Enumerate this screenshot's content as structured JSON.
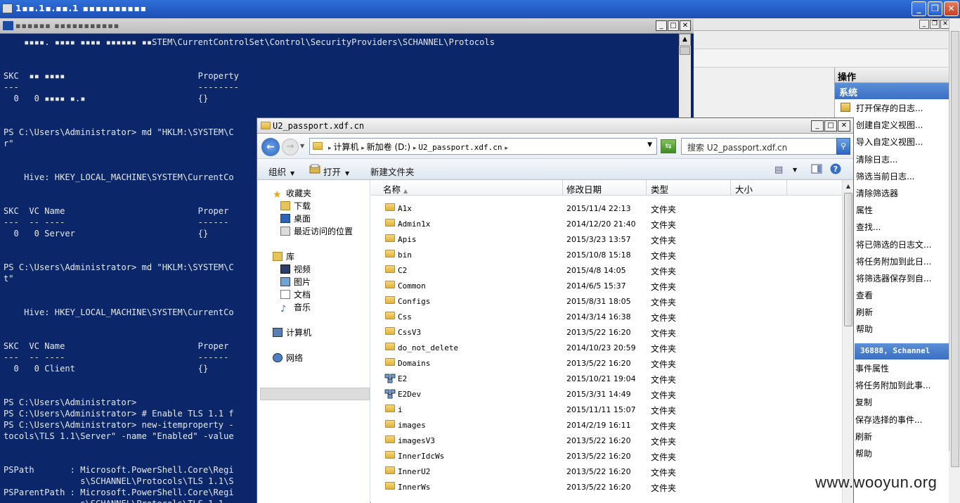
{
  "rdp": {
    "title": "1▪▪.1▪.▪▪.1  ▪▪▪▪▪▪▪▪▪▪"
  },
  "powershell": {
    "title": "▪▪▪▪▪▪  ▪▪▪▪▪▪▪▪▪▪▪",
    "lines": [
      "    ▪▪▪▪. ▪▪▪▪ ▪▪▪▪ ▪▪▪▪▪▪ ▪▪STEM\\CurrentControlSet\\Control\\SecurityProviders\\SCHANNEL\\Protocols",
      "",
      "",
      "SKC  ▪▪ ▪▪▪▪                          Property",
      "---                                   --------",
      "  0   0 ▪▪▪▪ ▪.▪                      {}",
      "",
      "",
      "PS C:\\Users\\Administrator> md \"HKLM:\\SYSTEM\\C",
      "r\"",
      "",
      "",
      "    Hive: HKEY_LOCAL_MACHINE\\SYSTEM\\CurrentCo",
      "",
      "",
      "SKC  VC Name                          Proper",
      "---  -- ----                          ------",
      "  0   0 Server                        {}",
      "",
      "",
      "PS C:\\Users\\Administrator> md \"HKLM:\\SYSTEM\\C",
      "t\"",
      "",
      "",
      "    Hive: HKEY_LOCAL_MACHINE\\SYSTEM\\CurrentCo",
      "",
      "",
      "SKC  VC Name                          Proper",
      "---  -- ----                          ------",
      "  0   0 Client                        {}",
      "",
      "",
      "PS C:\\Users\\Administrator>",
      "PS C:\\Users\\Administrator> # Enable TLS 1.1 f",
      "PS C:\\Users\\Administrator> new-itemproperty -",
      "tocols\\TLS 1.1\\Server\" -name \"Enabled\" -value",
      "",
      "",
      "PSPath       : Microsoft.PowerShell.Core\\Regi",
      "               s\\SCHANNEL\\Protocols\\TLS 1.1\\S",
      "PSParentPath : Microsoft.PowerShell.Core\\Regi",
      "               s\\SCHANNEL\\Protocols\\TLS 1.1"
    ]
  },
  "explorer": {
    "title": "U2_passport.xdf.cn",
    "address": [
      "计算机",
      "新加卷 (D:)",
      "U2_passport.xdf.cn"
    ],
    "search_placeholder": "搜索 U2_passport.xdf.cn",
    "commands": {
      "organize": "组织",
      "open": "打开",
      "new_folder": "新建文件夹"
    },
    "nav": {
      "favorites": "收藏夹",
      "downloads": "下载",
      "desktop": "桌面",
      "recent": "最近访问的位置",
      "library": "库",
      "videos": "视频",
      "pictures": "图片",
      "documents": "文档",
      "music": "音乐",
      "computer": "计算机",
      "network": "网络"
    },
    "columns": {
      "name": "名称",
      "date": "修改日期",
      "type": "类型",
      "size": "大小"
    },
    "files": [
      {
        "name": "A1x",
        "date": "2015/11/4 22:13",
        "type": "文件夹",
        "icon": "folder-icon"
      },
      {
        "name": "Admin1x",
        "date": "2014/12/20 21:40",
        "type": "文件夹",
        "icon": "folder-icon"
      },
      {
        "name": "Apis",
        "date": "2015/3/23 13:57",
        "type": "文件夹",
        "icon": "folder-icon"
      },
      {
        "name": "bin",
        "date": "2015/10/8 15:18",
        "type": "文件夹",
        "icon": "folder-icon"
      },
      {
        "name": "C2",
        "date": "2015/4/8 14:05",
        "type": "文件夹",
        "icon": "folder-icon"
      },
      {
        "name": "Common",
        "date": "2014/6/5 15:37",
        "type": "文件夹",
        "icon": "folder-icon"
      },
      {
        "name": "Configs",
        "date": "2015/8/31 18:05",
        "type": "文件夹",
        "icon": "folder-icon"
      },
      {
        "name": "Css",
        "date": "2014/3/14 16:38",
        "type": "文件夹",
        "icon": "folder-icon"
      },
      {
        "name": "CssV3",
        "date": "2013/5/22 16:20",
        "type": "文件夹",
        "icon": "folder-icon"
      },
      {
        "name": "do_not_delete",
        "date": "2014/10/23 20:59",
        "type": "文件夹",
        "icon": "folder-icon"
      },
      {
        "name": "Domains",
        "date": "2013/5/22 16:20",
        "type": "文件夹",
        "icon": "folder-icon"
      },
      {
        "name": "E2",
        "date": "2015/10/21 19:04",
        "type": "文件夹",
        "icon": "network-folder-icon"
      },
      {
        "name": "E2Dev",
        "date": "2015/3/31 14:49",
        "type": "文件夹",
        "icon": "network-folder-icon"
      },
      {
        "name": "i",
        "date": "2015/11/11 15:07",
        "type": "文件夹",
        "icon": "folder-icon"
      },
      {
        "name": "images",
        "date": "2014/2/19 16:11",
        "type": "文件夹",
        "icon": "folder-icon"
      },
      {
        "name": "imagesV3",
        "date": "2013/5/22 16:20",
        "type": "文件夹",
        "icon": "folder-icon"
      },
      {
        "name": "InnerIdcWs",
        "date": "2013/5/22 16:20",
        "type": "文件夹",
        "icon": "folder-icon"
      },
      {
        "name": "InnerU2",
        "date": "2013/5/22 16:20",
        "type": "文件夹",
        "icon": "folder-icon"
      },
      {
        "name": "InnerWs",
        "date": "2013/5/22 16:20",
        "type": "文件夹",
        "icon": "folder-icon"
      }
    ]
  },
  "actions": {
    "header": "操作",
    "section1": "系统",
    "items1": [
      "打开保存的日志...",
      "创建自定义视图...",
      "导入自定义视图...",
      "清除日志...",
      "筛选当前日志...",
      "清除筛选器",
      "属性",
      "查找...",
      "将已筛选的日志文...",
      "将任务附加到此日...",
      "将筛选器保存到自...",
      "查看",
      "刷新",
      "帮助"
    ],
    "section2": "36888, Schannel",
    "items2": [
      "事件属性",
      "将任务附加到此事...",
      "复制",
      "保存选择的事件...",
      "刷新",
      "帮助"
    ]
  },
  "watermark": "www.wooyun.org"
}
